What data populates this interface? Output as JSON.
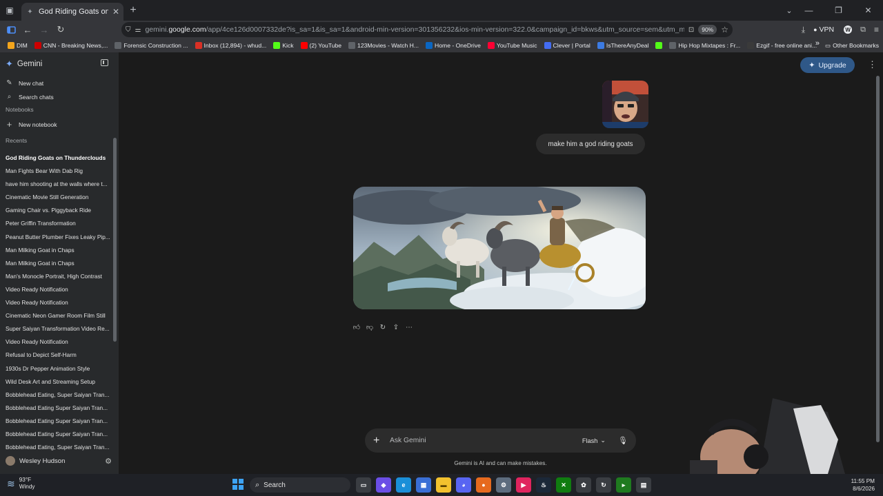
{
  "browser": {
    "tab_title": "God Riding Goats on Thunde",
    "url_prefix": "gemini.",
    "url_domain": "google.com",
    "url_rest": "/app/4ce126d0007332de?is_sa=1&is_sa=1&android-min-version=301356232&ios-min-version=322.0&campaign_id=bkws&utm_source=sem&utm_medium=paid-med",
    "zoom": "90%",
    "vpn_label": "VPN",
    "bookmarks": [
      {
        "label": "DIM",
        "icon": "dim-icon",
        "color": "#f4a51c"
      },
      {
        "label": "CNN - Breaking News,...",
        "icon": "cnn-icon",
        "color": "#cc0000"
      },
      {
        "label": "Forensic Construction ...",
        "icon": "globe-icon",
        "color": "#5f6368"
      },
      {
        "label": "Inbox (12,894) - whud...",
        "icon": "gmail-icon",
        "color": "#d93025"
      },
      {
        "label": "Kick",
        "icon": "kick-icon",
        "color": "#53fc18"
      },
      {
        "label": "(2) YouTube",
        "icon": "youtube-icon",
        "color": "#ff0000"
      },
      {
        "label": "123Movies - Watch H...",
        "icon": "globe-icon",
        "color": "#5f6368"
      },
      {
        "label": "Home - OneDrive",
        "icon": "onedrive-icon",
        "color": "#0a66c2"
      },
      {
        "label": "YouTube Music",
        "icon": "youtube-music-icon",
        "color": "#ff0033"
      },
      {
        "label": "Clever | Portal",
        "icon": "clever-icon",
        "color": "#436cf2"
      },
      {
        "label": "IsThereAnyDeal",
        "icon": "itad-icon",
        "color": "#3c7be3"
      },
      {
        "label": "",
        "icon": "kick-icon",
        "color": "#53fc18"
      },
      {
        "label": "Hip Hop Mixtapes : Fr...",
        "icon": "document-icon",
        "color": "#5f6368"
      },
      {
        "label": "Ezgif - free online ani...",
        "icon": "ezgif-icon",
        "color": "#3a3a3a"
      }
    ],
    "other_bookmarks": "Other Bookmarks"
  },
  "sidebar": {
    "app_name": "Gemini",
    "new_chat": "New chat",
    "search_chats": "Search chats",
    "notebooks_heading": "Notebooks",
    "new_notebook": "New notebook",
    "recents_heading": "Recents",
    "recents": [
      "God Riding Goats on Thunderclouds",
      "Man Fights Bear With Dab Rig",
      "have him shooting at the walls where t...",
      "Cinematic Movie Still Generation",
      "Gaming Chair vs. Piggyback Ride",
      "Peter Griffin Transformation",
      "Peanut Butter Plumber Fixes Leaky Pip...",
      "Man Milking Goat in Chaps",
      "Man Milking Goat in Chaps",
      "Man's Monocle Portrait, High Contrast",
      "Video Ready Notification",
      "Video Ready Notification",
      "Cinematic Neon Gamer Room Film Still",
      "Super Saiyan Transformation Video Re...",
      "Video Ready Notification",
      "Refusal to Depict Self-Harm",
      "1930s Dr Pepper Animation Style",
      "Wild Desk Art and Streaming Setup",
      "Bobblehead Eating, Super Saiyan Tran...",
      "Bobblehead Eating Super Saiyan Tran...",
      "Bobblehead Eating Super Saiyan Tran...",
      "Bobblehead Eating Super Saiyan Tran...",
      "Bobblehead Eating, Super Saiyan Tran..."
    ],
    "user_name": "Wesley Hudson"
  },
  "main": {
    "upgrade_label": "Upgrade",
    "user_message": "make him a god riding goats",
    "input_placeholder": "Ask Gemini",
    "model_label": "Flash",
    "disclaimer": "Gemini is AI and can make mistakes."
  },
  "taskbar": {
    "temperature": "93°F",
    "weather_desc": "Windy",
    "search_label": "Search",
    "time": "11:55 PM",
    "date": "8/6/2026"
  },
  "colors": {
    "accent_upgrade": "#2f5888",
    "sidebar_bg": "#282a2c",
    "main_bg": "#1b1b1b"
  }
}
